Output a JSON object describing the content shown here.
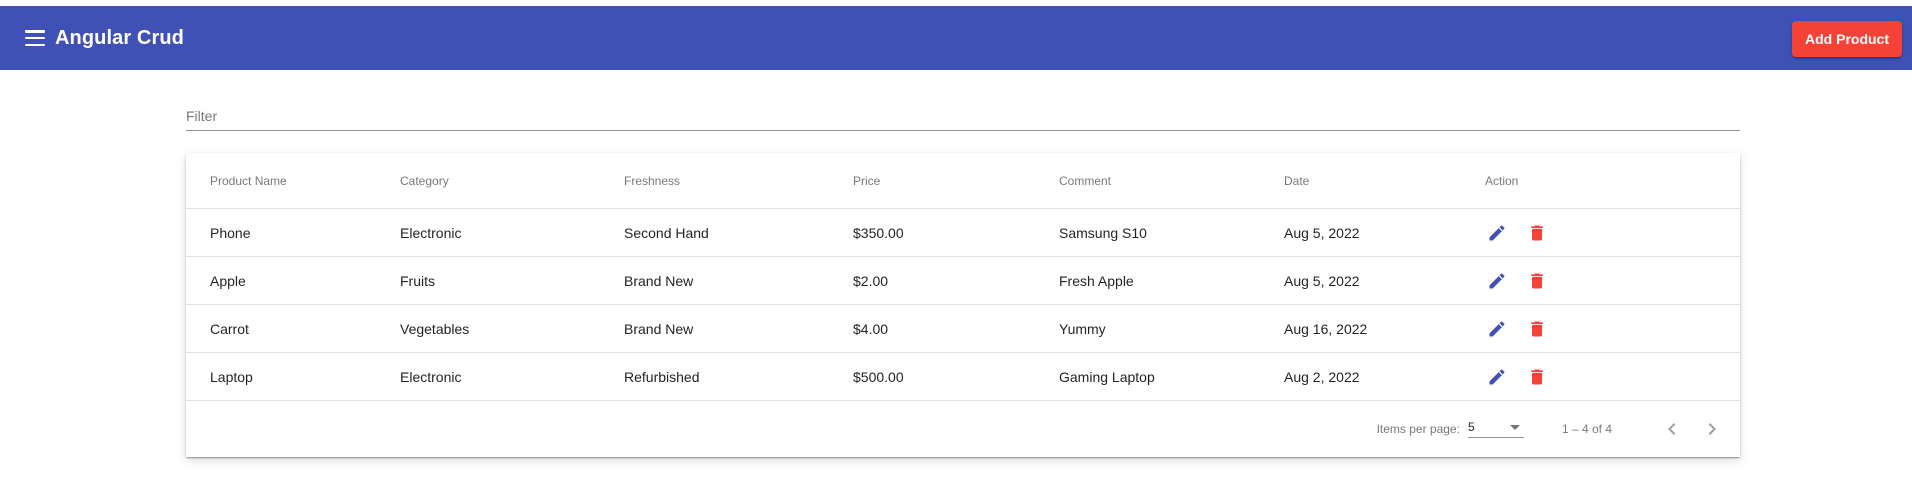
{
  "toolbar": {
    "title": "Angular Crud",
    "add_label": "Add Product",
    "bg": "#3f51b5",
    "accent": "#f44336"
  },
  "filter": {
    "placeholder": "Filter",
    "value": ""
  },
  "table": {
    "headers": [
      "Product Name",
      "Category",
      "Freshness",
      "Price",
      "Comment",
      "Date",
      "Action"
    ],
    "rows": [
      [
        "Phone",
        "Electronic",
        "Second Hand",
        "$350.00",
        "Samsung S10",
        "Aug 5, 2022"
      ],
      [
        "Apple",
        "Fruits",
        "Brand New",
        "$2.00",
        "Fresh Apple",
        "Aug 5, 2022"
      ],
      [
        "Carrot",
        "Vegetables",
        "Brand New",
        "$4.00",
        "Yummy",
        "Aug 16, 2022"
      ],
      [
        "Laptop",
        "Electronic",
        "Refurbished",
        "$500.00",
        "Gaming Laptop",
        "Aug 2, 2022"
      ]
    ],
    "icons": {
      "edit": "edit-icon",
      "delete": "delete-icon"
    },
    "edit_color": "#3f51b5",
    "delete_color": "#f44336"
  },
  "paginator": {
    "items_per_page_label": "Items per page:",
    "page_size": "5",
    "range": "1 – 4 of 4"
  }
}
